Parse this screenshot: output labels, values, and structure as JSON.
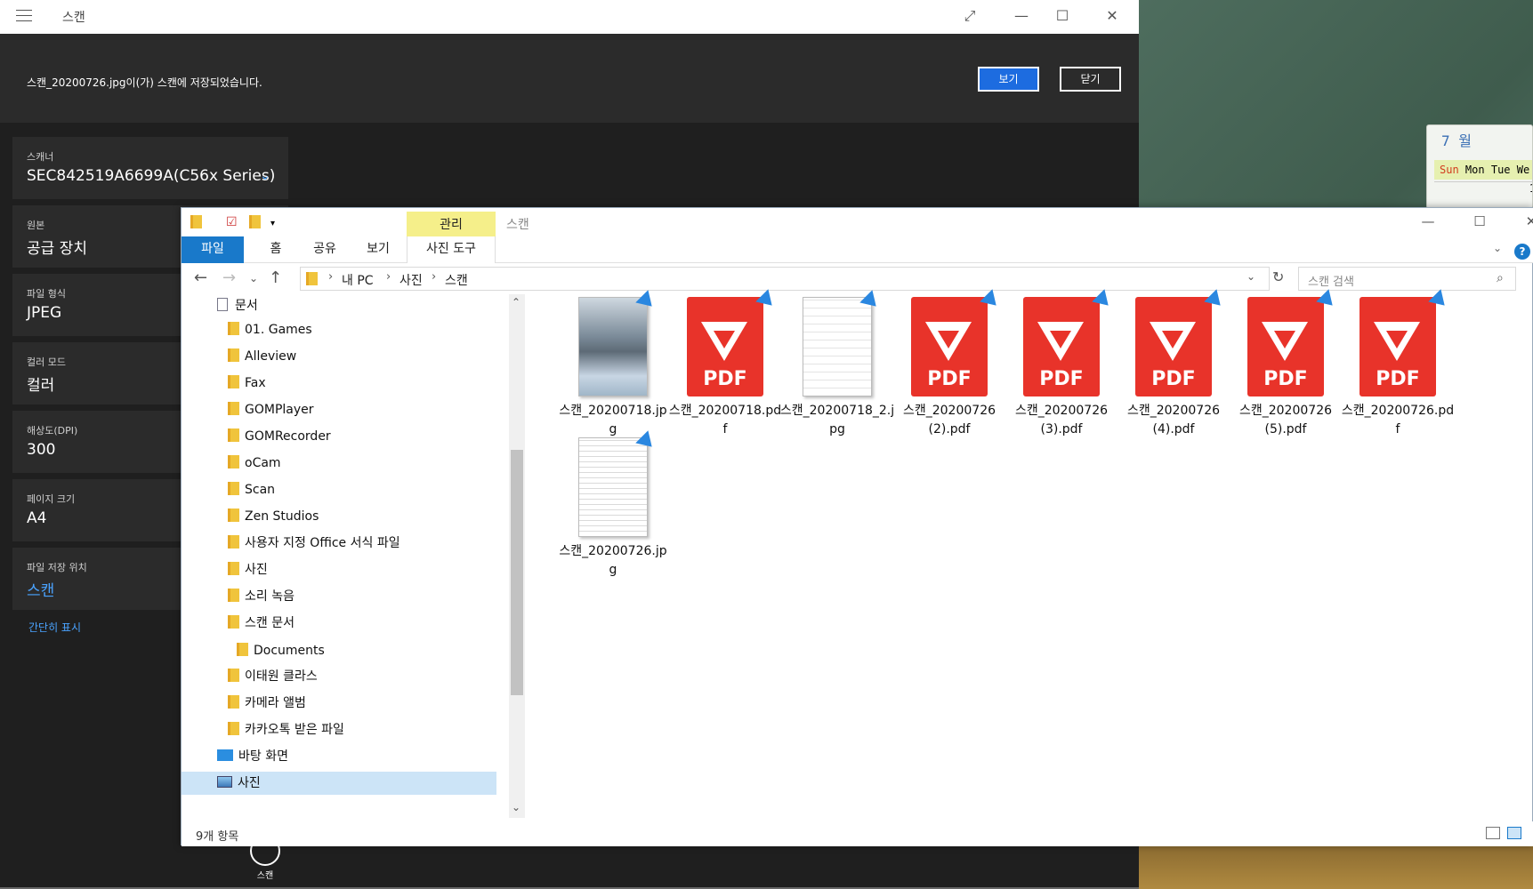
{
  "scan_app": {
    "title": "스캔",
    "notification": "스캔_20200726.jpg이(가) 스캔에 저장되었습니다.",
    "view_button": "보기",
    "close_button": "닫기",
    "settings": [
      {
        "label": "스캐너",
        "value": "SEC842519A6699A(C56x Series)"
      },
      {
        "label": "원본",
        "value": "공급 장치"
      },
      {
        "label": "파일 형식",
        "value": "JPEG"
      },
      {
        "label": "컬러 모드",
        "value": "컬러"
      },
      {
        "label": "해상도(DPI)",
        "value": "300"
      },
      {
        "label": "페이지 크기",
        "value": "A4"
      },
      {
        "label": "파일 저장 위치",
        "value": "스캔"
      }
    ],
    "simple_link": "간단히 표시",
    "scan_button_label": "스캔",
    "accent_color": "#1d6ce0",
    "link_color": "#4aa3ff"
  },
  "explorer": {
    "title": "스캔",
    "manage_tab": "관리",
    "ribbon_tabs": [
      "파일",
      "홈",
      "공유",
      "보기",
      "사진 도구"
    ],
    "breadcrumb": [
      "내 PC",
      "사진",
      "스캔"
    ],
    "search_placeholder": "스캔 검색",
    "nav_items": [
      {
        "label": "문서",
        "icon": "document-icon"
      },
      {
        "label": "01. Games",
        "icon": "folder-icon"
      },
      {
        "label": "Alleview",
        "icon": "folder-icon"
      },
      {
        "label": "Fax",
        "icon": "folder-icon"
      },
      {
        "label": "GOMPlayer",
        "icon": "folder-icon"
      },
      {
        "label": "GOMRecorder",
        "icon": "folder-icon"
      },
      {
        "label": "oCam",
        "icon": "folder-icon"
      },
      {
        "label": "Scan",
        "icon": "folder-icon"
      },
      {
        "label": "Zen Studios",
        "icon": "folder-icon"
      },
      {
        "label": "사용자 지정 Office 서식 파일",
        "icon": "folder-icon"
      },
      {
        "label": "사진",
        "icon": "folder-icon"
      },
      {
        "label": "소리 녹음",
        "icon": "folder-icon"
      },
      {
        "label": "스캔 문서",
        "icon": "folder-icon"
      },
      {
        "label": "Documents",
        "icon": "folder-icon"
      },
      {
        "label": "이태원 클라스",
        "icon": "folder-icon"
      },
      {
        "label": "카메라 앨범",
        "icon": "folder-icon"
      },
      {
        "label": "카카오톡 받은 파일",
        "icon": "folder-icon"
      },
      {
        "label": "바탕 화면",
        "icon": "desktop-icon"
      },
      {
        "label": "사진",
        "icon": "pictures-icon",
        "selected": true
      }
    ],
    "files": [
      {
        "name": "스캔_20200718.jpg",
        "type": "jpg-photo"
      },
      {
        "name": "스캔_20200718.pdf",
        "type": "pdf"
      },
      {
        "name": "스캔_20200718_2.jpg",
        "type": "jpg-sketch"
      },
      {
        "name": "스캔_20200726 (2).pdf",
        "type": "pdf"
      },
      {
        "name": "스캔_20200726 (3).pdf",
        "type": "pdf"
      },
      {
        "name": "스캔_20200726 (4).pdf",
        "type": "pdf"
      },
      {
        "name": "스캔_20200726 (5).pdf",
        "type": "pdf"
      },
      {
        "name": "스캔_20200726.pdf",
        "type": "pdf"
      },
      {
        "name": "스캔_20200726.jpg",
        "type": "jpg-doc"
      }
    ],
    "pdf_label": "PDF",
    "item_count": "9개 항목",
    "ribbon_color": "#1979ca",
    "pdf_color": "#e8332a"
  },
  "calendar": {
    "month": "7 월",
    "days": [
      "Sun",
      "Mon",
      "Tue",
      "We"
    ],
    "first_date": "1"
  }
}
